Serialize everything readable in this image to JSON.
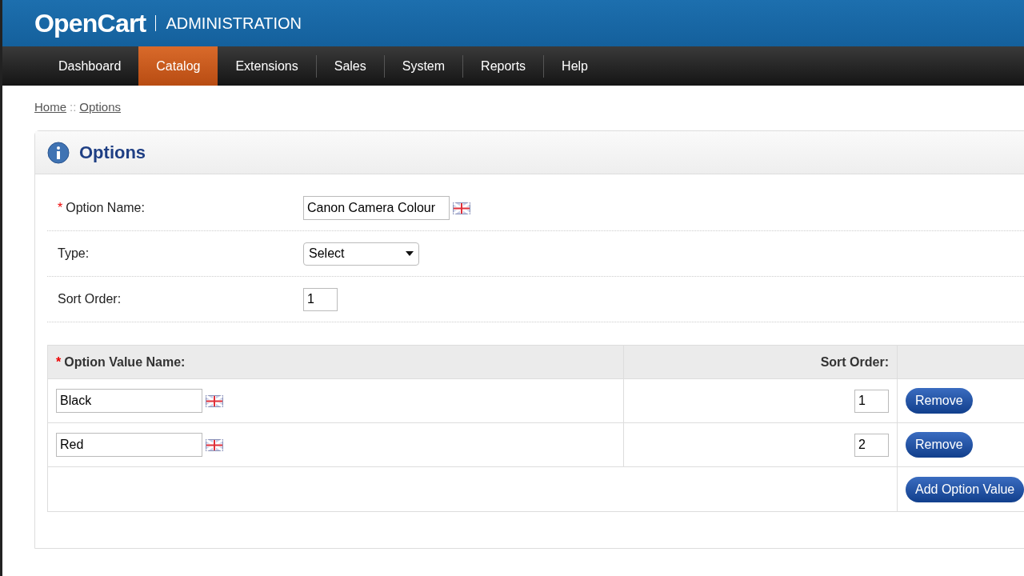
{
  "header": {
    "logo": "OpenCart",
    "subtitle": "ADMINISTRATION"
  },
  "nav": [
    {
      "label": "Dashboard",
      "selected": false
    },
    {
      "label": "Catalog",
      "selected": true
    },
    {
      "label": "Extensions",
      "selected": false
    },
    {
      "label": "Sales",
      "selected": false
    },
    {
      "label": "System",
      "selected": false
    },
    {
      "label": "Reports",
      "selected": false
    },
    {
      "label": "Help",
      "selected": false
    }
  ],
  "breadcrumb": [
    {
      "label": "Home"
    },
    {
      "label": "Options"
    }
  ],
  "breadcrumb_separator": "::",
  "panel": {
    "title": "Options"
  },
  "form": [
    {
      "kind": "text-flag",
      "label": "Option Name:",
      "marker": "*",
      "value": "Canon Camera Colour"
    },
    {
      "kind": "select",
      "label": "Type:",
      "value": "Select"
    },
    {
      "kind": "small",
      "label": "Sort Order:",
      "value": "1"
    }
  ],
  "values_table": {
    "columns": [
      {
        "label": "Option Value Name:",
        "marker": "*"
      },
      {
        "label": "Sort Order:"
      }
    ],
    "rows": [
      {
        "name": "Black",
        "sort_order": "1",
        "action": "Remove"
      },
      {
        "name": "Red",
        "sort_order": "2",
        "action": "Remove"
      }
    ],
    "add_button": "Add Option Value"
  }
}
